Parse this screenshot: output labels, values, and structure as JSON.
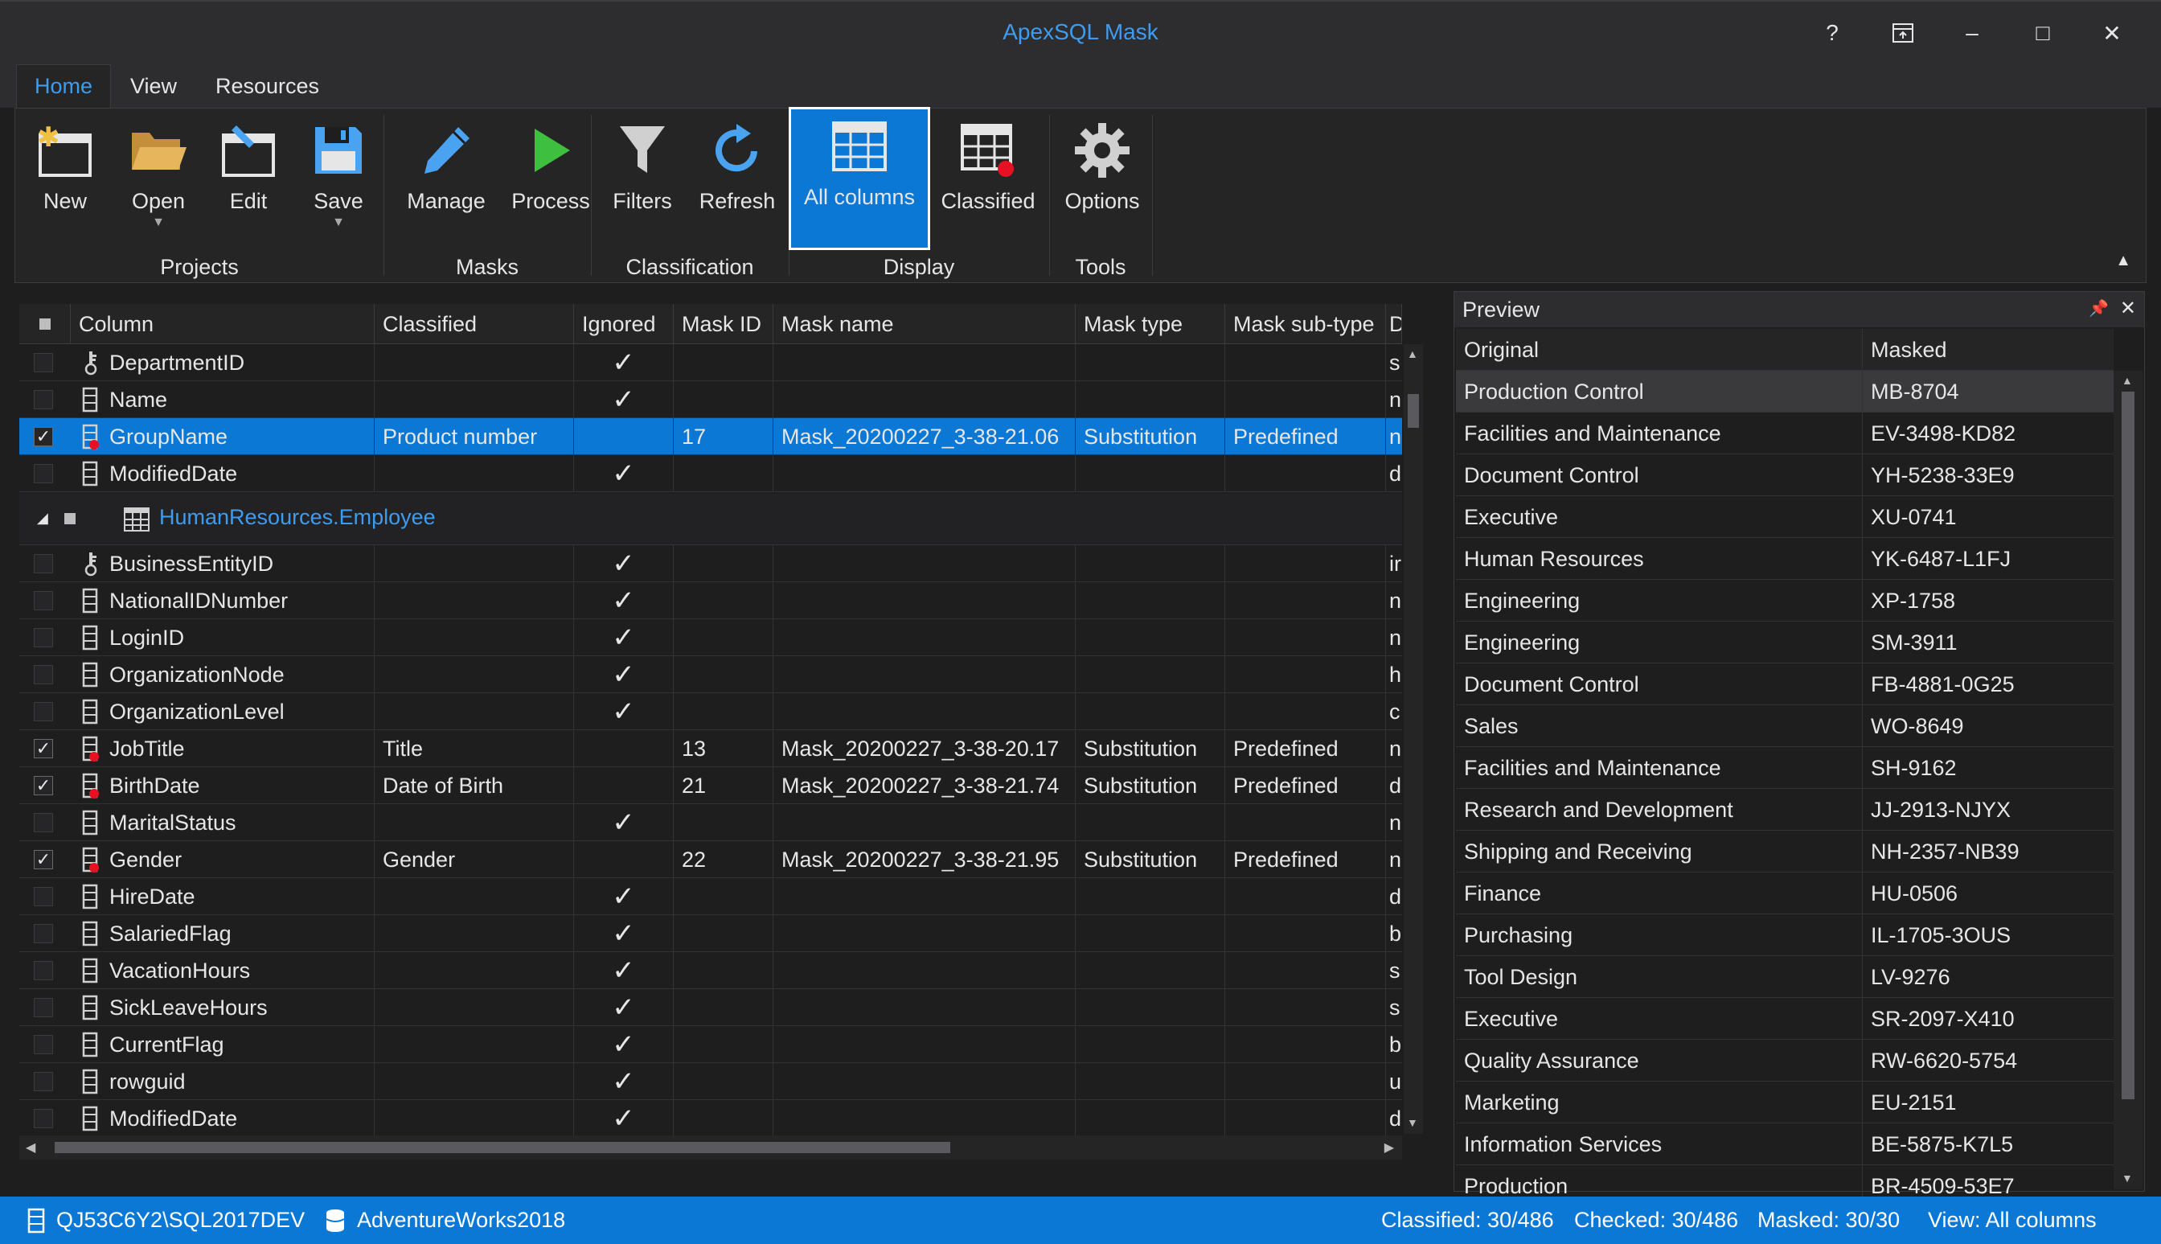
{
  "window": {
    "title": "ApexSQL Mask",
    "help": "?",
    "restore_icon": "dock-icon",
    "minimize": "–",
    "maximize": "□",
    "close": "✕"
  },
  "tabs": [
    {
      "label": "Home",
      "active": true
    },
    {
      "label": "View"
    },
    {
      "label": "Resources"
    }
  ],
  "ribbon": {
    "buttons": {
      "new": "New",
      "open": "Open",
      "edit": "Edit",
      "save": "Save",
      "manage": "Manage",
      "process": "Process",
      "filters": "Filters",
      "refresh": "Refresh",
      "all_columns": "All columns",
      "classified": "Classified",
      "options": "Options"
    },
    "groups": {
      "projects": "Projects",
      "masks": "Masks",
      "classification": "Classification",
      "display": "Display",
      "tools": "Tools"
    }
  },
  "grid": {
    "headers": [
      "Column",
      "Classified",
      "Ignored",
      "Mask ID",
      "Mask name",
      "Mask type",
      "Mask sub-type",
      "Data"
    ],
    "group_table": "HumanResources.Employee",
    "rows_top": [
      {
        "name": "DepartmentID",
        "icon": "key",
        "classified": "",
        "ignored": true,
        "mask_id": "",
        "mask_name": "",
        "mask_type": "",
        "sub_type": "",
        "data": "s"
      },
      {
        "name": "Name",
        "icon": "column",
        "classified": "",
        "ignored": true,
        "mask_id": "",
        "mask_name": "",
        "mask_type": "",
        "sub_type": "",
        "data": "n"
      },
      {
        "name": "GroupName",
        "icon": "classified",
        "checked": true,
        "selected": true,
        "classified": "Product number",
        "ignored": false,
        "mask_id": "17",
        "mask_name": "Mask_20200227_3-38-21.06",
        "mask_type": "Substitution",
        "sub_type": "Predefined",
        "data": "n"
      },
      {
        "name": "ModifiedDate",
        "icon": "column",
        "classified": "",
        "ignored": true,
        "mask_id": "",
        "mask_name": "",
        "mask_type": "",
        "sub_type": "",
        "data": "d"
      }
    ],
    "rows_bottom": [
      {
        "name": "BusinessEntityID",
        "icon": "key",
        "classified": "",
        "ignored": true,
        "mask_id": "",
        "mask_name": "",
        "mask_type": "",
        "sub_type": "",
        "data": "ir"
      },
      {
        "name": "NationalIDNumber",
        "icon": "column",
        "classified": "",
        "ignored": true,
        "mask_id": "",
        "mask_name": "",
        "mask_type": "",
        "sub_type": "",
        "data": "n"
      },
      {
        "name": "LoginID",
        "icon": "column",
        "classified": "",
        "ignored": true,
        "mask_id": "",
        "mask_name": "",
        "mask_type": "",
        "sub_type": "",
        "data": "n"
      },
      {
        "name": "OrganizationNode",
        "icon": "column",
        "classified": "",
        "ignored": true,
        "mask_id": "",
        "mask_name": "",
        "mask_type": "",
        "sub_type": "",
        "data": "h"
      },
      {
        "name": "OrganizationLevel",
        "icon": "column",
        "classified": "",
        "ignored": true,
        "mask_id": "",
        "mask_name": "",
        "mask_type": "",
        "sub_type": "",
        "data": "c"
      },
      {
        "name": "JobTitle",
        "icon": "classified",
        "checked": true,
        "classified": "Title",
        "ignored": false,
        "mask_id": "13",
        "mask_name": "Mask_20200227_3-38-20.17",
        "mask_type": "Substitution",
        "sub_type": "Predefined",
        "data": "n"
      },
      {
        "name": "BirthDate",
        "icon": "classified",
        "checked": true,
        "classified": "Date of Birth",
        "ignored": false,
        "mask_id": "21",
        "mask_name": "Mask_20200227_3-38-21.74",
        "mask_type": "Substitution",
        "sub_type": "Predefined",
        "data": "d"
      },
      {
        "name": "MaritalStatus",
        "icon": "column",
        "classified": "",
        "ignored": true,
        "mask_id": "",
        "mask_name": "",
        "mask_type": "",
        "sub_type": "",
        "data": "n"
      },
      {
        "name": "Gender",
        "icon": "classified",
        "checked": true,
        "classified": "Gender",
        "ignored": false,
        "mask_id": "22",
        "mask_name": "Mask_20200227_3-38-21.95",
        "mask_type": "Substitution",
        "sub_type": "Predefined",
        "data": "n"
      },
      {
        "name": "HireDate",
        "icon": "column",
        "classified": "",
        "ignored": true,
        "mask_id": "",
        "mask_name": "",
        "mask_type": "",
        "sub_type": "",
        "data": "d"
      },
      {
        "name": "SalariedFlag",
        "icon": "column",
        "classified": "",
        "ignored": true,
        "mask_id": "",
        "mask_name": "",
        "mask_type": "",
        "sub_type": "",
        "data": "b"
      },
      {
        "name": "VacationHours",
        "icon": "column",
        "classified": "",
        "ignored": true,
        "mask_id": "",
        "mask_name": "",
        "mask_type": "",
        "sub_type": "",
        "data": "s"
      },
      {
        "name": "SickLeaveHours",
        "icon": "column",
        "classified": "",
        "ignored": true,
        "mask_id": "",
        "mask_name": "",
        "mask_type": "",
        "sub_type": "",
        "data": "s"
      },
      {
        "name": "CurrentFlag",
        "icon": "column",
        "classified": "",
        "ignored": true,
        "mask_id": "",
        "mask_name": "",
        "mask_type": "",
        "sub_type": "",
        "data": "b"
      },
      {
        "name": "rowguid",
        "icon": "column",
        "classified": "",
        "ignored": true,
        "mask_id": "",
        "mask_name": "",
        "mask_type": "",
        "sub_type": "",
        "data": "u"
      },
      {
        "name": "ModifiedDate",
        "icon": "column",
        "classified": "",
        "ignored": true,
        "mask_id": "",
        "mask_name": "",
        "mask_type": "",
        "sub_type": "",
        "data": "d"
      }
    ]
  },
  "preview": {
    "title": "Preview",
    "headers": [
      "Original",
      "Masked"
    ],
    "rows": [
      [
        "Production Control",
        "MB-8704"
      ],
      [
        "Facilities and Maintenance",
        "EV-3498-KD82"
      ],
      [
        "Document Control",
        "YH-5238-33E9"
      ],
      [
        "Executive",
        "XU-0741"
      ],
      [
        "Human Resources",
        "YK-6487-L1FJ"
      ],
      [
        "Engineering",
        "XP-1758"
      ],
      [
        "Engineering",
        "SM-3911"
      ],
      [
        "Document Control",
        "FB-4881-0G25"
      ],
      [
        "Sales",
        "WO-8649"
      ],
      [
        "Facilities and Maintenance",
        "SH-9162"
      ],
      [
        "Research and Development",
        "JJ-2913-NJYX"
      ],
      [
        "Shipping and Receiving",
        "NH-2357-NB39"
      ],
      [
        "Finance",
        "HU-0506"
      ],
      [
        "Purchasing",
        "IL-1705-3OUS"
      ],
      [
        "Tool Design",
        "LV-9276"
      ],
      [
        "Executive",
        "SR-2097-X410"
      ],
      [
        "Quality Assurance",
        "RW-6620-5754"
      ],
      [
        "Marketing",
        "EU-2151"
      ],
      [
        "Information Services",
        "BE-5875-K7L5"
      ],
      [
        "Production",
        "BR-4509-53E7"
      ]
    ]
  },
  "status": {
    "server": "QJ53C6Y2\\SQL2017DEV",
    "database": "AdventureWorks2018",
    "classified": "Classified: 30/486",
    "checked": "Checked: 30/486",
    "masked": "Masked: 30/30",
    "view": "View: All columns"
  },
  "colors": {
    "accent": "#0a78d4",
    "title": "#3e9cf0",
    "classified_dot": "#e81123",
    "save_icon": "#4aa3f0",
    "process_icon": "#3fbf3f",
    "open_icon": "#d9a94e"
  }
}
